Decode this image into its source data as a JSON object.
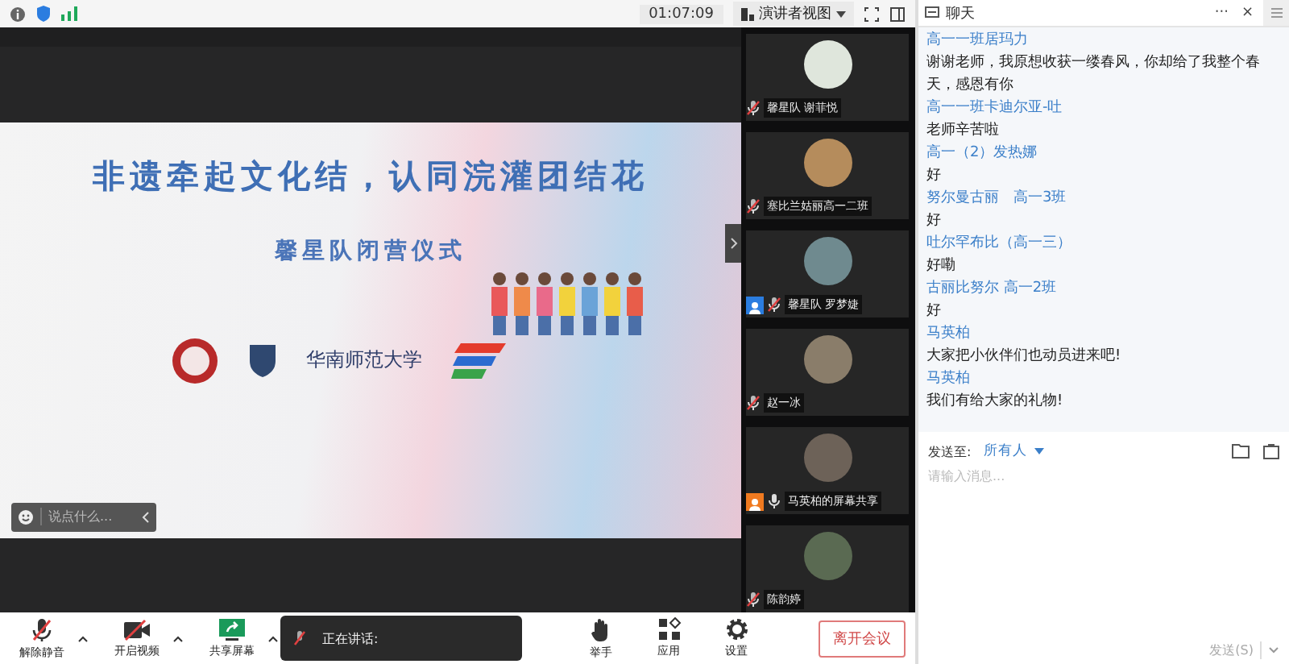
{
  "top_bar": {
    "timer": "01:07:09",
    "view_button": "演讲者视图"
  },
  "slide": {
    "title": "非遗牵起文化结，认同浣灌团结花",
    "subtitle": "馨星队闭营仪式",
    "university": "华南师范大学"
  },
  "comment_field": {
    "placeholder": "说点什么..."
  },
  "gallery": [
    {
      "name": "馨星队 谢菲悦",
      "mic_muted": true,
      "host": false,
      "sharing": false
    },
    {
      "name": "塞比兰姑丽高一二班",
      "mic_muted": true,
      "host": false,
      "sharing": false
    },
    {
      "name": "馨星队 罗梦婕",
      "mic_muted": true,
      "host": true,
      "sharing": false
    },
    {
      "name": "赵一冰",
      "mic_muted": true,
      "host": false,
      "sharing": false
    },
    {
      "name": "马英柏的屏幕共享",
      "mic_muted": false,
      "host": false,
      "sharing": true
    },
    {
      "name": "陈韵婷",
      "mic_muted": true,
      "host": false,
      "sharing": false
    }
  ],
  "toolbar": {
    "buttons": [
      {
        "label": "解除静音",
        "kind": "mic",
        "caret": true
      },
      {
        "label": "开启视频",
        "kind": "video",
        "caret": true
      },
      {
        "label": "共享屏幕",
        "kind": "share",
        "caret": true
      },
      {
        "label": "举手",
        "kind": "hand",
        "caret": false
      },
      {
        "label": "应用",
        "kind": "apps",
        "caret": false
      },
      {
        "label": "设置",
        "kind": "settings",
        "caret": false
      }
    ],
    "speaking_label": "正在讲话:",
    "leave_button": "离开会议"
  },
  "chat": {
    "title": "聊天",
    "more": "···",
    "close": "×",
    "messages": [
      {
        "sender": "高一一班居玛力",
        "text": "谢谢老师，我原想收获一缕春风，你却给了我整个春天，感恩有你"
      },
      {
        "sender": "高一一班卡迪尔亚-吐",
        "text": "老师辛苦啦"
      },
      {
        "sender": "高一（2）发热娜",
        "text": "好"
      },
      {
        "sender": "努尔曼古丽　高一3班",
        "text": "好"
      },
      {
        "sender": "吐尔罕布比（高一三）",
        "text": "好嘞"
      },
      {
        "sender": "古丽比努尔 高一2班",
        "text": "好"
      },
      {
        "sender": "马英柏",
        "text": "大家把小伙伴们也动员进来吧!"
      },
      {
        "sender": "马英柏",
        "text": "我们有给大家的礼物!"
      }
    ],
    "send_to_label": "发送至:",
    "recipient": "所有人",
    "input": {
      "placeholder": "请输入消息..."
    },
    "send_button": "发送(S)"
  }
}
